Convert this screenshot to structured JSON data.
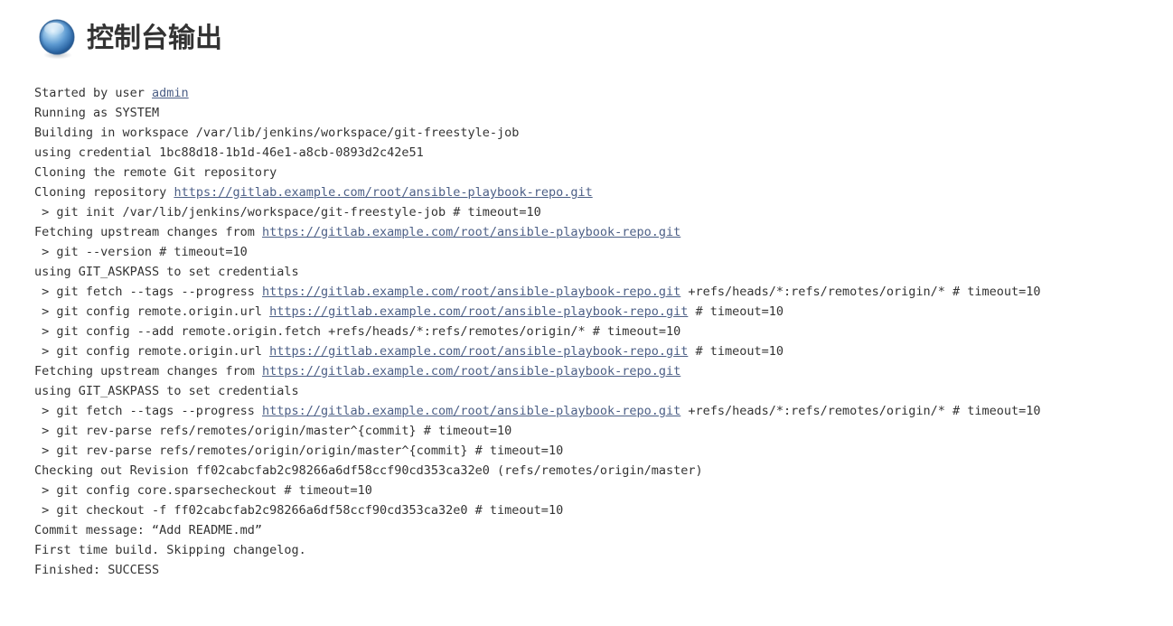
{
  "header": {
    "title": "控制台输出",
    "icon": "blue-sphere-icon"
  },
  "colors": {
    "text": "#333333",
    "link": "#4c5f86",
    "background": "#ffffff",
    "sphere_light": "#bcd9f0",
    "sphere_mid": "#4a8cc8",
    "sphere_dark": "#20558f"
  },
  "console": {
    "repo_url": "https://gitlab.example.com/root/ansible-playbook-repo.git",
    "user": "admin",
    "workspace": "/var/lib/jenkins/workspace/git-freestyle-job",
    "credential_id": "1bc88d18-1b1d-46e1-a8cb-0893d2c42e51",
    "commit_sha": "ff02cabcfab2c98266a6df58ccf90cd353ca32e0",
    "commit_message": "“Add README.md”",
    "result": "SUCCESS",
    "lines": [
      [
        {
          "t": "Started by user "
        },
        {
          "t": "admin",
          "link": true
        }
      ],
      [
        {
          "t": "Running as SYSTEM"
        }
      ],
      [
        {
          "t": "Building in workspace /var/lib/jenkins/workspace/git-freestyle-job"
        }
      ],
      [
        {
          "t": "using credential 1bc88d18-1b1d-46e1-a8cb-0893d2c42e51"
        }
      ],
      [
        {
          "t": "Cloning the remote Git repository"
        }
      ],
      [
        {
          "t": "Cloning repository "
        },
        {
          "t": "https://gitlab.example.com/root/ansible-playbook-repo.git",
          "link": true
        }
      ],
      [
        {
          "t": " > git init /var/lib/jenkins/workspace/git-freestyle-job # timeout=10"
        }
      ],
      [
        {
          "t": "Fetching upstream changes from "
        },
        {
          "t": "https://gitlab.example.com/root/ansible-playbook-repo.git",
          "link": true
        }
      ],
      [
        {
          "t": " > git --version # timeout=10"
        }
      ],
      [
        {
          "t": "using GIT_ASKPASS to set credentials"
        }
      ],
      [
        {
          "t": " > git fetch --tags --progress "
        },
        {
          "t": "https://gitlab.example.com/root/ansible-playbook-repo.git",
          "link": true
        },
        {
          "t": " +refs/heads/*:refs/remotes/origin/* # timeout=10"
        }
      ],
      [
        {
          "t": " > git config remote.origin.url "
        },
        {
          "t": "https://gitlab.example.com/root/ansible-playbook-repo.git",
          "link": true
        },
        {
          "t": " # timeout=10"
        }
      ],
      [
        {
          "t": " > git config --add remote.origin.fetch +refs/heads/*:refs/remotes/origin/* # timeout=10"
        }
      ],
      [
        {
          "t": " > git config remote.origin.url "
        },
        {
          "t": "https://gitlab.example.com/root/ansible-playbook-repo.git",
          "link": true
        },
        {
          "t": " # timeout=10"
        }
      ],
      [
        {
          "t": "Fetching upstream changes from "
        },
        {
          "t": "https://gitlab.example.com/root/ansible-playbook-repo.git",
          "link": true
        }
      ],
      [
        {
          "t": "using GIT_ASKPASS to set credentials"
        }
      ],
      [
        {
          "t": " > git fetch --tags --progress "
        },
        {
          "t": "https://gitlab.example.com/root/ansible-playbook-repo.git",
          "link": true
        },
        {
          "t": " +refs/heads/*:refs/remotes/origin/* # timeout=10"
        }
      ],
      [
        {
          "t": " > git rev-parse refs/remotes/origin/master^{commit} # timeout=10"
        }
      ],
      [
        {
          "t": " > git rev-parse refs/remotes/origin/origin/master^{commit} # timeout=10"
        }
      ],
      [
        {
          "t": "Checking out Revision ff02cabcfab2c98266a6df58ccf90cd353ca32e0 (refs/remotes/origin/master)"
        }
      ],
      [
        {
          "t": " > git config core.sparsecheckout # timeout=10"
        }
      ],
      [
        {
          "t": " > git checkout -f ff02cabcfab2c98266a6df58ccf90cd353ca32e0 # timeout=10"
        }
      ],
      [
        {
          "t": "Commit message: “Add README.md”"
        }
      ],
      [
        {
          "t": "First time build. Skipping changelog."
        }
      ],
      [
        {
          "t": "Finished: SUCCESS"
        }
      ]
    ]
  }
}
